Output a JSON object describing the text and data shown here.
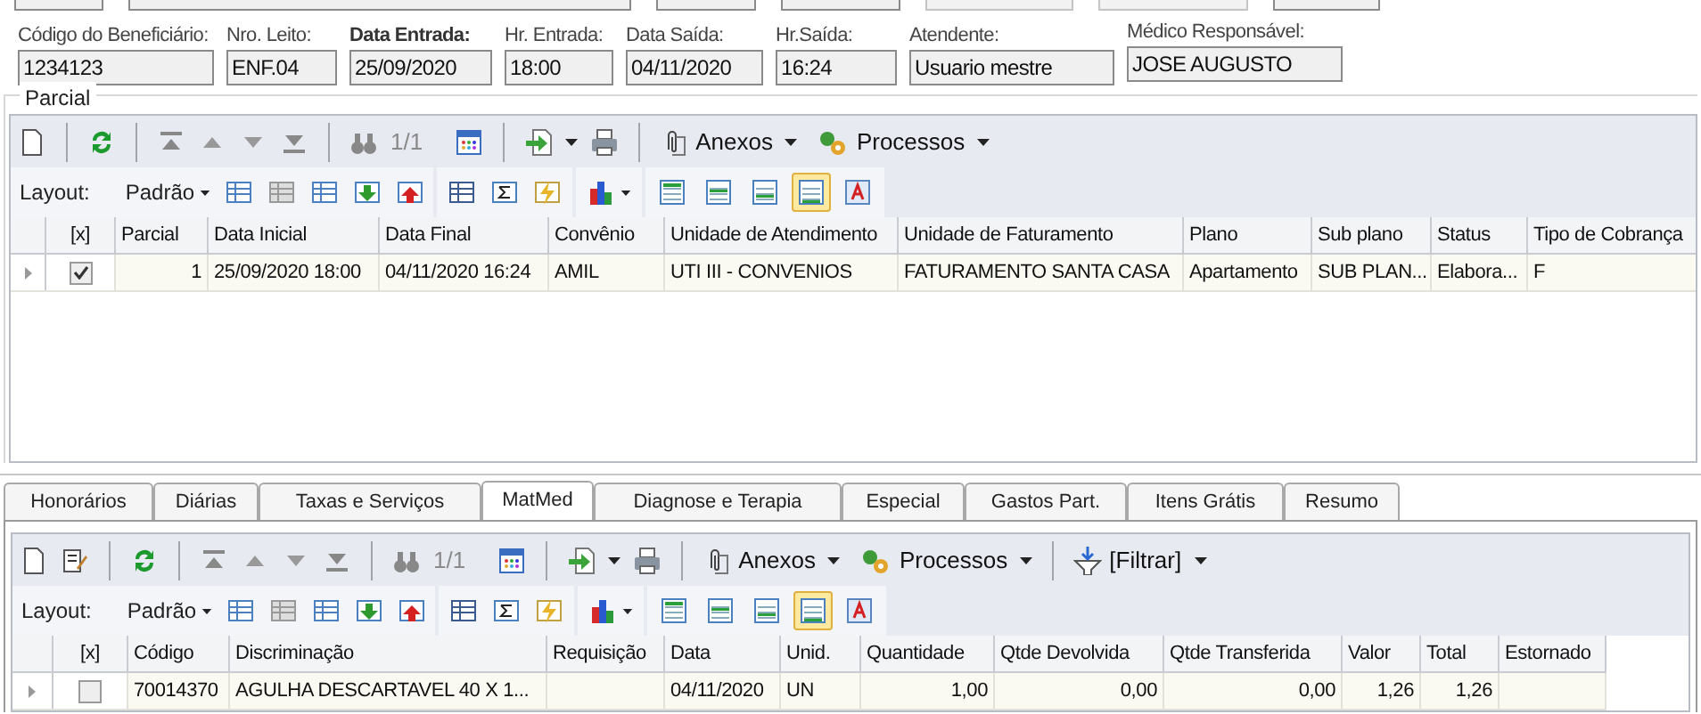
{
  "header_fields": [
    {
      "label": "Código do Beneficiário:",
      "value": "1234123",
      "bold": false
    },
    {
      "label": "Nro. Leito:",
      "value": "ENF.04",
      "bold": false
    },
    {
      "label": "Data Entrada:",
      "value": "25/09/2020",
      "bold": true
    },
    {
      "label": "Hr. Entrada:",
      "value": "18:00",
      "bold": false
    },
    {
      "label": "Data Saída:",
      "value": "04/11/2020",
      "bold": false
    },
    {
      "label": "Hr.Saída:",
      "value": "16:24",
      "bold": false
    },
    {
      "label": "Atendente:",
      "value": "Usuario mestre",
      "bold": false
    },
    {
      "label": "Médico Responsável:",
      "value": "JOSE AUGUSTO",
      "bold": false
    }
  ],
  "parcial": {
    "title": "Parcial",
    "toolbar": {
      "record_count": "1/1",
      "attachments": "Anexos",
      "processes": "Processos",
      "layout_label": "Layout:",
      "layout_value": "Padrão",
      "view_buttons": [
        {
          "selected": false
        },
        {
          "selected": false
        },
        {
          "selected": false
        },
        {
          "selected": true
        },
        {
          "selected": false
        }
      ]
    },
    "table": {
      "columns": [
        "[x]",
        "Parcial",
        "Data Inicial",
        "Data Final",
        "Convênio",
        "Unidade de Atendimento",
        "Unidade de Faturamento",
        "Plano",
        "Sub plano",
        "Status",
        "Tipo de Cobrança"
      ],
      "rows": [
        {
          "checked": true,
          "cells": [
            "",
            "1",
            "25/09/2020 18:00",
            "04/11/2020 16:24",
            "AMIL",
            "UTI III - CONVENIOS",
            "FATURAMENTO SANTA CASA",
            "Apartamento",
            "SUB PLAN...",
            "Elabora...",
            "F"
          ]
        }
      ]
    }
  },
  "tabs": [
    {
      "label": "Honorários",
      "selected": false
    },
    {
      "label": "Diárias",
      "selected": false
    },
    {
      "label": "Taxas e Serviços",
      "selected": false
    },
    {
      "label": "MatMed",
      "selected": true
    },
    {
      "label": "Diagnose e Terapia",
      "selected": false
    },
    {
      "label": "Especial",
      "selected": false
    },
    {
      "label": "Gastos Part.",
      "selected": false
    },
    {
      "label": "Itens Grátis",
      "selected": false
    },
    {
      "label": "Resumo",
      "selected": false
    }
  ],
  "items": {
    "toolbar": {
      "record_count": "1/1",
      "attachments": "Anexos",
      "processes": "Processos",
      "filter": "[Filtrar]",
      "layout_label": "Layout:",
      "layout_value": "Padrão",
      "view_buttons": [
        {
          "selected": false
        },
        {
          "selected": false
        },
        {
          "selected": false
        },
        {
          "selected": true
        },
        {
          "selected": false
        }
      ]
    },
    "table": {
      "columns": [
        "[x]",
        "Código",
        "Discriminação",
        "Requisição",
        "Data",
        "Unid.",
        "Quantidade",
        "Qtde Devolvida",
        "Qtde Transferida",
        "Valor",
        "Total",
        "Estornado"
      ],
      "rows": [
        {
          "checked": false,
          "cells": [
            "",
            "70014370",
            "AGULHA DESCARTAVEL 40 X 1...",
            "",
            "04/11/2020",
            "UN",
            "1,00",
            "0,00",
            "0,00",
            "1,26",
            "1,26",
            ""
          ]
        }
      ]
    }
  }
}
